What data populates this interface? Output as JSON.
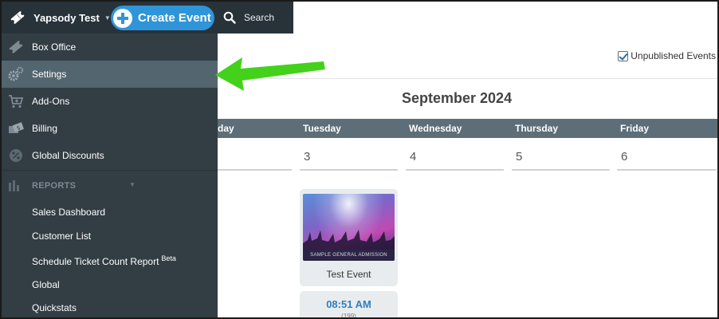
{
  "topbar": {
    "account_name": "Yapsody Test",
    "create_label": "Create Event",
    "search_label": "Search"
  },
  "sidebar": {
    "items": [
      {
        "label": "Box Office",
        "icon": "ticket-icon"
      },
      {
        "label": "Settings",
        "icon": "gears-icon",
        "active": true
      },
      {
        "label": "Add-Ons",
        "icon": "cart-plus-icon"
      },
      {
        "label": "Billing",
        "icon": "billing-icon"
      },
      {
        "label": "Global Discounts",
        "icon": "discount-icon"
      }
    ],
    "reports_label": "REPORTS",
    "reports": [
      {
        "label": "Sales Dashboard"
      },
      {
        "label": "Customer List"
      },
      {
        "label": "Schedule Ticket Count Report",
        "badge": "Beta"
      },
      {
        "label": "Global"
      },
      {
        "label": "Quickstats"
      }
    ]
  },
  "calendar": {
    "unpublished_label": "Unpublished Events",
    "unpublished_checked": true,
    "month": "September 2024",
    "partial_day": "day",
    "days": [
      {
        "name": "Tuesday",
        "num": "3"
      },
      {
        "name": "Wednesday",
        "num": "4"
      },
      {
        "name": "Thursday",
        "num": "5"
      },
      {
        "name": "Friday",
        "num": "6"
      }
    ],
    "event": {
      "image_caption": "SAMPLE GENERAL ADMISSION",
      "title": "Test Event",
      "time": "08:51 AM",
      "count": "(199)"
    }
  },
  "colors": {
    "sidebar_bg": "#323d44",
    "topbar_bg": "#283239",
    "active_item": "#53656f",
    "accent_blue": "#2f95d8",
    "annotation_arrow": "#43d11c"
  }
}
